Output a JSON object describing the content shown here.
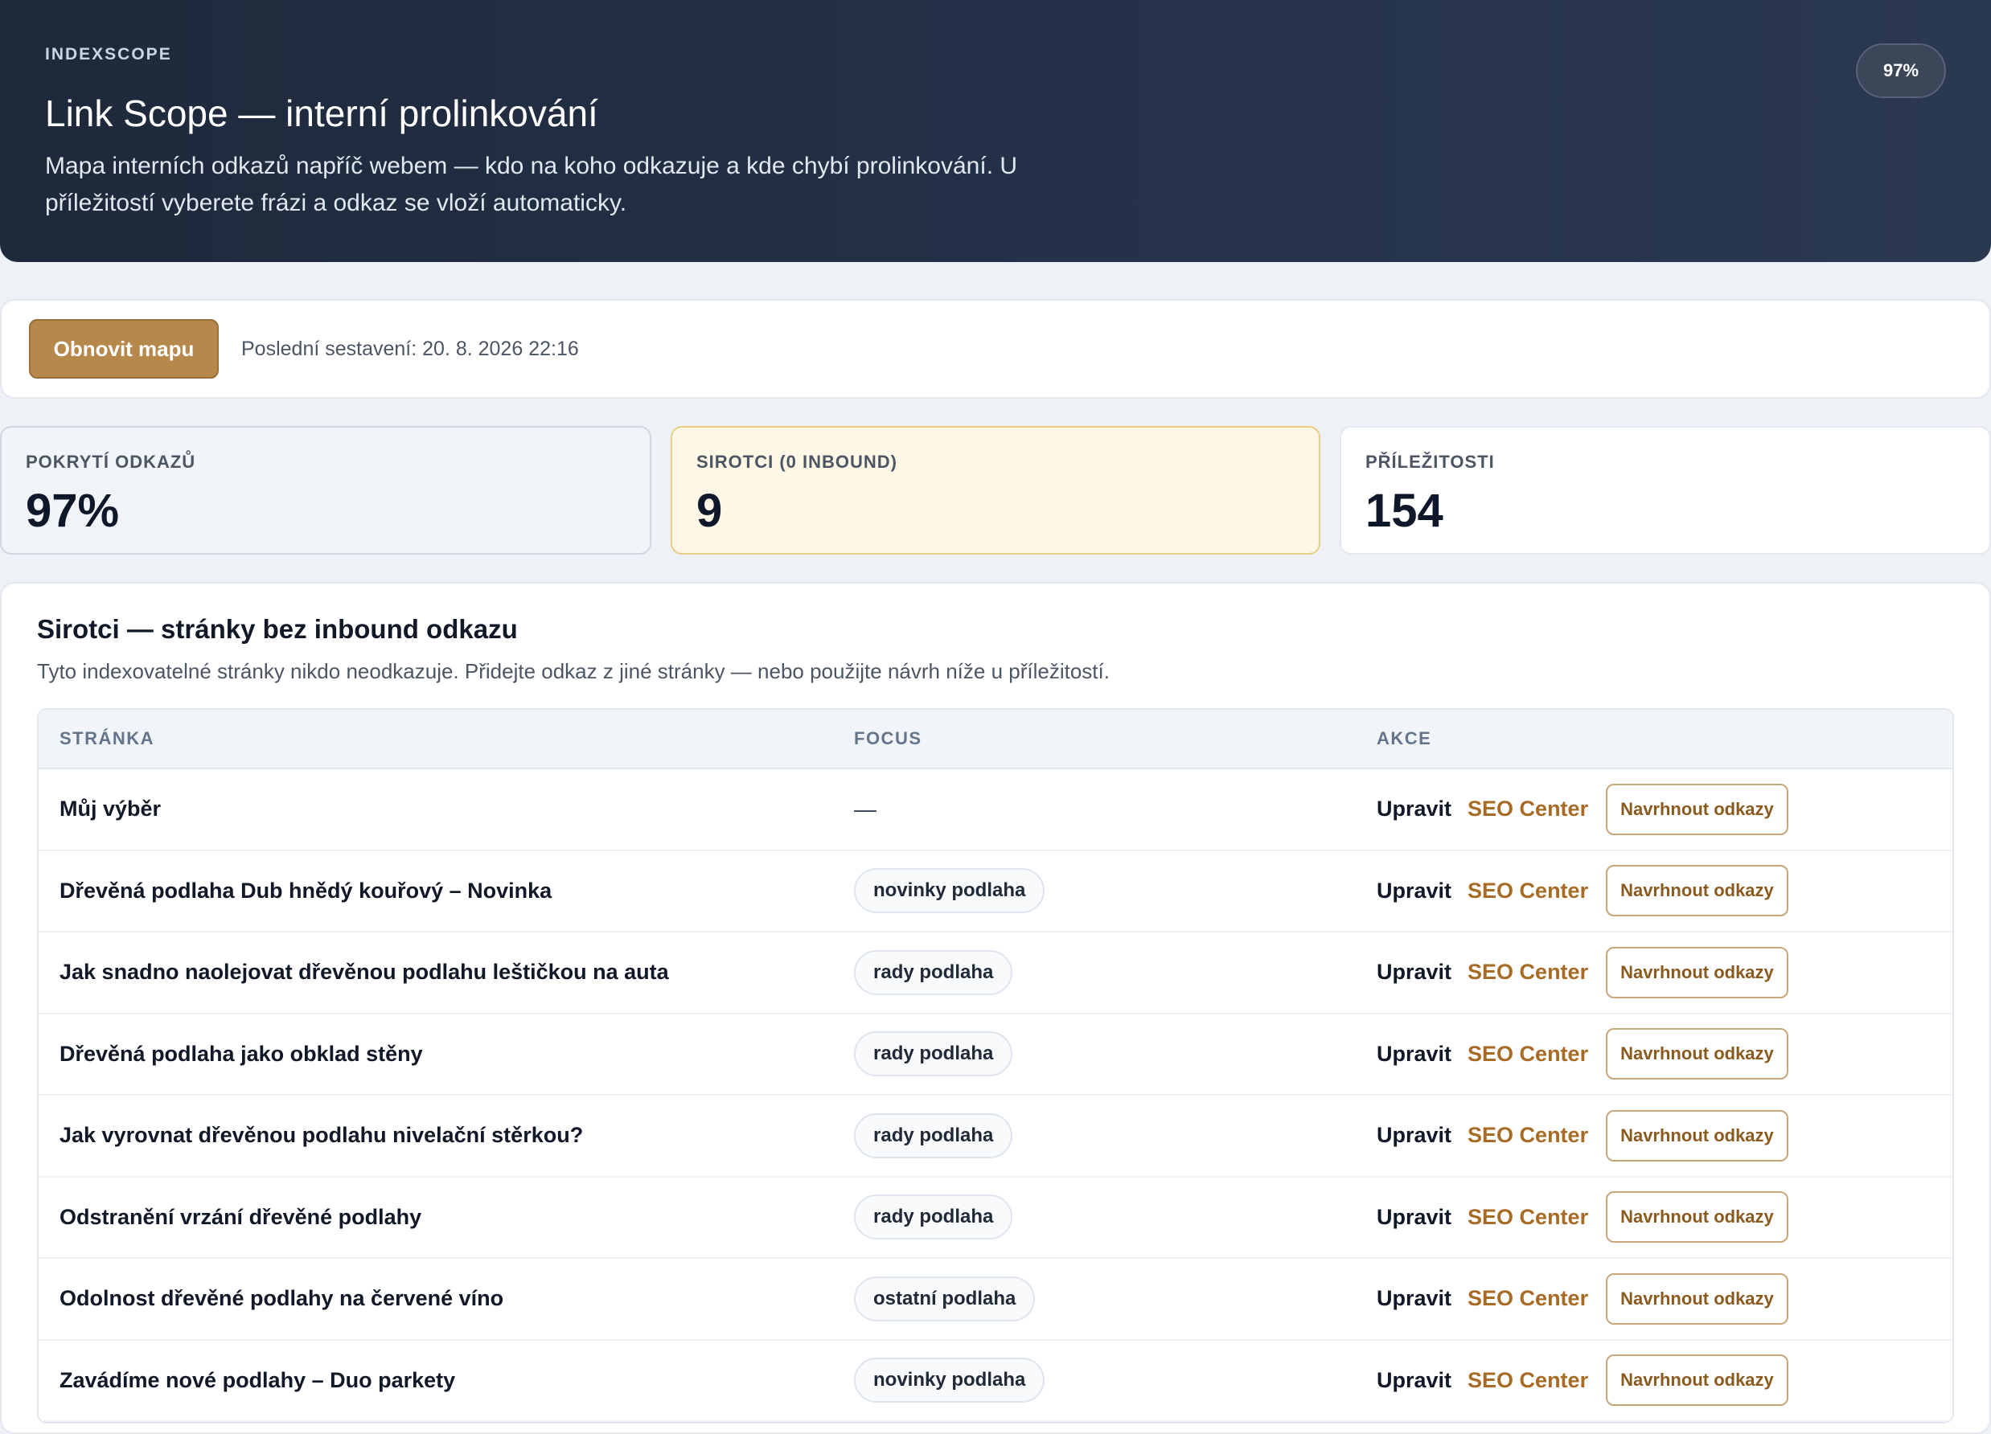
{
  "header": {
    "brand": "INDEXSCOPE",
    "title": "Link Scope — interní prolinkování",
    "description": "Mapa interních odkazů napříč webem — kdo na koho odkazuje a kde chybí prolinkování. U příležitostí vyberete frázi a odkaz se vloží automaticky.",
    "badge": "97%"
  },
  "toolbar": {
    "refresh_label": "Obnovit mapu",
    "last_built": "Poslední sestavení: 20. 8. 2026 22:16"
  },
  "stats": [
    {
      "label": "POKRYTÍ ODKAZŮ",
      "value": "97%"
    },
    {
      "label": "SIROTCI (0 INBOUND)",
      "value": "9"
    },
    {
      "label": "PŘÍLEŽITOSTI",
      "value": "154"
    }
  ],
  "orphans": {
    "title": "Sirotci — stránky bez inbound odkazu",
    "description": "Tyto indexovatelné stránky nikdo neodkazuje. Přidejte odkaz z jiné stránky — nebo použijte návrh níže u příležitostí.",
    "columns": [
      "STRÁNKA",
      "FOCUS",
      "AKCE"
    ],
    "actions": {
      "edit": "Upravit",
      "seo": "SEO Center",
      "suggest": "Navrhnout odkazy"
    },
    "rows": [
      {
        "page": "Můj výběr",
        "focus": "—",
        "has_chip": false
      },
      {
        "page": "Dřevěná podlaha Dub hnědý kouřový – Novinka",
        "focus": "novinky podlaha",
        "has_chip": true
      },
      {
        "page": "Jak snadno naolejovat dřevěnou podlahu leštičkou na auta",
        "focus": "rady podlaha",
        "has_chip": true
      },
      {
        "page": "Dřevěná podlaha jako obklad stěny",
        "focus": "rady podlaha",
        "has_chip": true
      },
      {
        "page": "Jak vyrovnat dřevěnou podlahu nivelační stěrkou?",
        "focus": "rady podlaha",
        "has_chip": true
      },
      {
        "page": "Odstranění vrzání dřevěné podlahy",
        "focus": "rady podlaha",
        "has_chip": true
      },
      {
        "page": "Odolnost dřevěné podlahy na červené víno",
        "focus": "ostatní podlaha",
        "has_chip": true
      },
      {
        "page": "Zavádíme nové podlahy – Duo parkety",
        "focus": "novinky podlaha",
        "has_chip": true
      }
    ]
  }
}
